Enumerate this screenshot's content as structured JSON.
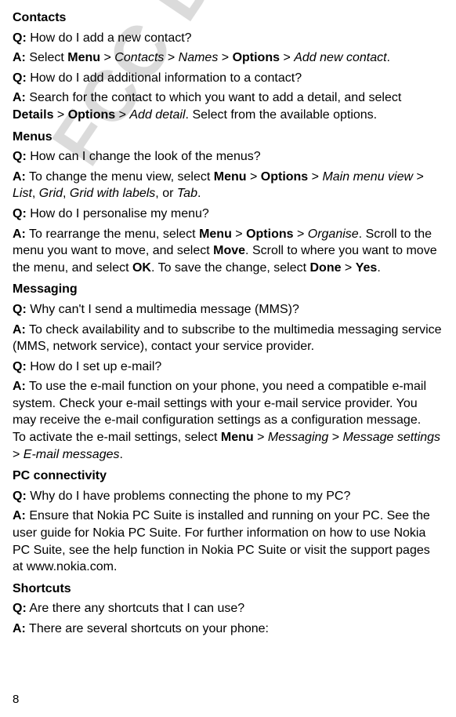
{
  "watermark": "FCC DRAFT",
  "page_number": "8",
  "sections": {
    "contacts": {
      "title": "Contacts",
      "q1_label": "Q:",
      "q1_text": " How do I add a new contact?",
      "a1_label": "A:",
      "a1_text1": " Select ",
      "a1_menu": "Menu",
      "a1_gt1": " > ",
      "a1_contacts": "Contacts",
      "a1_gt2": " > ",
      "a1_names": "Names",
      "a1_gt3": " > ",
      "a1_options": "Options",
      "a1_gt4": " > ",
      "a1_addnew": "Add new contact",
      "a1_end": ".",
      "q2_label": "Q:",
      "q2_text": " How do I add additional information to a contact?",
      "a2_label": "A:",
      "a2_text1": " Search for the contact to which you want to add a detail, and select ",
      "a2_details": "Details",
      "a2_gt1": " > ",
      "a2_options": "Options",
      "a2_gt2": " > ",
      "a2_adddetail": "Add detail",
      "a2_text2": ". Select from the available options."
    },
    "menus": {
      "title": "Menus",
      "q1_label": "Q:",
      "q1_text": " How can I change the look of the menus?",
      "a1_label": "A:",
      "a1_text1": " To change the menu view, select ",
      "a1_menu": "Menu",
      "a1_gt1": " > ",
      "a1_options": "Options",
      "a1_gt2": " > ",
      "a1_mainview": "Main menu view",
      "a1_gt3": " > ",
      "a1_list": "List",
      "a1_comma1": ", ",
      "a1_grid": "Grid",
      "a1_comma2": ", ",
      "a1_gridlabels": "Grid with labels",
      "a1_or": ", or ",
      "a1_tab": "Tab",
      "a1_end": ".",
      "q2_label": "Q:",
      "q2_text": " How do I personalise my menu?",
      "a2_label": "A:",
      "a2_text1": " To rearrange the menu, select ",
      "a2_menu": "Menu",
      "a2_gt1": " > ",
      "a2_options": "Options",
      "a2_gt2": " > ",
      "a2_organise": "Organise",
      "a2_text2": ". Scroll to the menu you want to move, and select ",
      "a2_move": "Move",
      "a2_text3": ". Scroll to where you want to move the menu, and select ",
      "a2_ok": "OK",
      "a2_text4": ". To save the change, select ",
      "a2_done": "Done",
      "a2_gt3": " > ",
      "a2_yes": "Yes",
      "a2_end": "."
    },
    "messaging": {
      "title": "Messaging",
      "q1_label": "Q:",
      "q1_text": " Why can't I send a multimedia message (MMS)?",
      "a1_label": "A:",
      "a1_text": " To check availability and to subscribe to the multimedia messaging service (MMS, network service), contact your service provider.",
      "q2_label": "Q:",
      "q2_text": " How do I set up e-mail?",
      "a2_label": "A:",
      "a2_text1": " To use the e-mail function on your phone, you need a compatible e-mail system. Check your e-mail settings with your e-mail service provider. You may receive the e-mail configuration settings as a configuration message.",
      "a2_text2": "To activate the e-mail settings, select ",
      "a2_menu": "Menu",
      "a2_gt1": " > ",
      "a2_messaging": "Messaging",
      "a2_gt2": " > ",
      "a2_msgsettings": "Message settings",
      "a2_gt3": " > ",
      "a2_emailmsgs": "E-mail messages",
      "a2_end": "."
    },
    "pc": {
      "title": "PC connectivity",
      "q1_label": "Q:",
      "q1_text": " Why do I have problems connecting the phone to my PC?",
      "a1_label": "A:",
      "a1_text": " Ensure that Nokia PC Suite is installed and running on your PC. See the user guide for Nokia PC Suite. For further information on how to use Nokia PC Suite, see the help function in Nokia PC Suite or visit the support pages at www.nokia.com."
    },
    "shortcuts": {
      "title": "Shortcuts",
      "q1_label": "Q:",
      "q1_text": " Are there any shortcuts that I can use?",
      "a1_label": "A:",
      "a1_text": " There are several shortcuts on your phone:"
    }
  }
}
